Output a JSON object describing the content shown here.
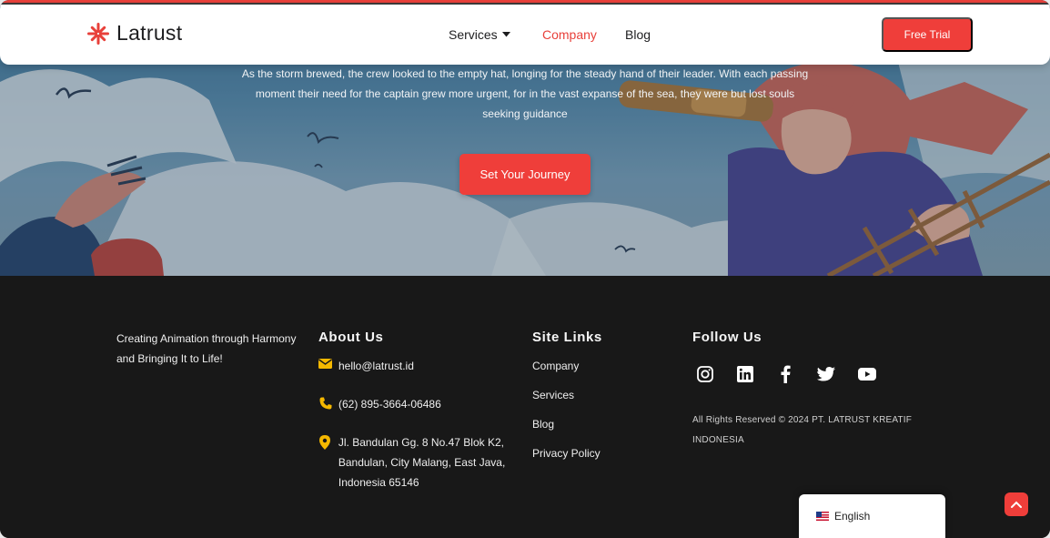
{
  "header": {
    "brand": "Latrust",
    "nav": [
      {
        "label": "Services",
        "has_dropdown": true
      },
      {
        "label": "Company",
        "active": true
      },
      {
        "label": "Blog"
      }
    ],
    "cta": "Free Trial"
  },
  "hero": {
    "text": "As the storm brewed, the crew looked to the empty hat, longing for the steady hand of their leader. With each passing moment their need for the captain grew more urgent, for in the vast expanse of the sea, they were but lost souls seeking guidance",
    "button": "Set Your Journey"
  },
  "footer": {
    "tagline": "Creating Animation through Harmony and Bringing It to Life!",
    "about": {
      "title": "About Us",
      "email": "hello@latrust.id",
      "phone": "(62) 895-3664-06486",
      "address": "Jl. Bandulan Gg. 8 No.47 Blok K2, Bandulan, City Malang, East Java, Indonesia 65146"
    },
    "site_links": {
      "title": "Site Links",
      "items": [
        "Company",
        "Services",
        "Blog",
        "Privacy Policy"
      ]
    },
    "follow": {
      "title": "Follow Us",
      "icons": [
        "instagram-icon",
        "linkedin-icon",
        "facebook-icon",
        "twitter-icon",
        "youtube-icon"
      ]
    },
    "copyright": "All Rights Reserved © 2024 PT. LATRUST KREATIF INDONESIA",
    "language": "English"
  },
  "colors": {
    "accent": "#ef3e3a",
    "footer_bg": "#181818",
    "contact_icon": "#f5b800"
  }
}
